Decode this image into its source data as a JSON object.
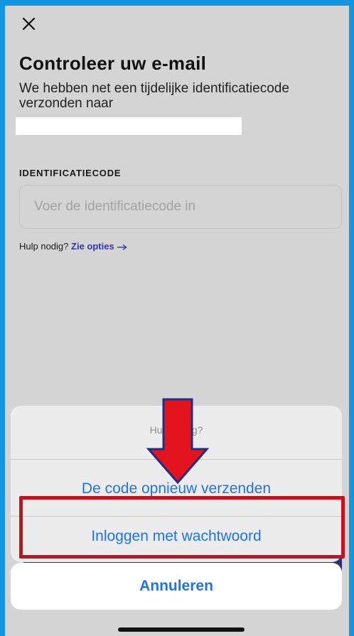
{
  "header": {
    "close_icon": "close-icon"
  },
  "page": {
    "title": "Controleer uw e-mail",
    "description": "We hebben net een tijdelijke identificatiecode verzonden naar"
  },
  "form": {
    "code_label": "IDENTIFICATIECODE",
    "code_placeholder": "Voer de identificatiecode in",
    "code_value": ""
  },
  "help": {
    "prompt": "Hulp nodig?",
    "link_label": "Zie opties",
    "link_icon": "arrow-right-icon"
  },
  "action_sheet": {
    "title": "Hulp nodig?",
    "actions": [
      {
        "label": "De code opnieuw verzenden"
      },
      {
        "label": "Inloggen met wachtwoord"
      }
    ],
    "cancel_label": "Annuleren"
  },
  "annotation": {
    "arrow_color": "#e3141e",
    "arrow_outline_color": "#1c2f8a",
    "highlight_color": "#c0141e"
  },
  "colors": {
    "action_blue": "#1e74e6",
    "link_navy": "#2e3a9e",
    "frame_blue": "#1296e0"
  }
}
